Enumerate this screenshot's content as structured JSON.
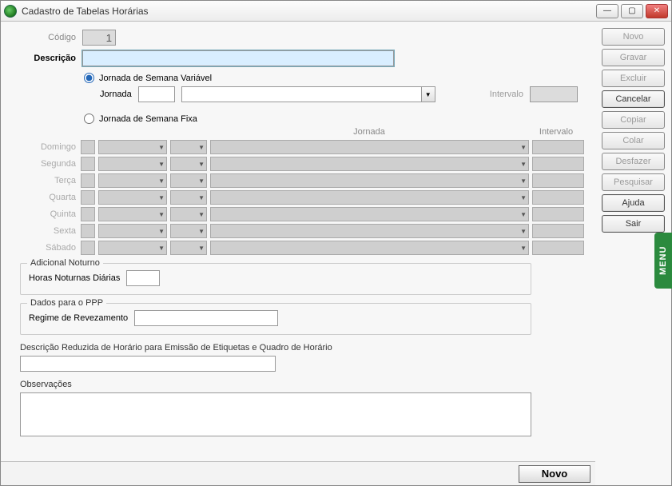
{
  "window": {
    "title": "Cadastro de Tabelas Horárias"
  },
  "fields": {
    "codigo_label": "Código",
    "codigo_value": "1",
    "descricao_label": "Descrição",
    "descricao_value": "",
    "jornada_var_label": "Jornada de Semana Variável",
    "jornada_fixa_label": "Jornada de Semana Fixa",
    "jornada_sub_label": "Jornada",
    "intervalo_label": "Intervalo",
    "jornada_header": "Jornada",
    "intervalo_header": "Intervalo"
  },
  "days": [
    "Domingo",
    "Segunda",
    "Terça",
    "Quarta",
    "Quinta",
    "Sexta",
    "Sábado"
  ],
  "adicional_noturno": {
    "legend": "Adicional Noturno",
    "horas_label": "Horas Noturnas Diárias",
    "horas_value": ""
  },
  "ppp": {
    "legend": "Dados para o PPP",
    "regime_label": "Regime de Revezamento",
    "regime_value": ""
  },
  "descricao_reduzida": {
    "label": "Descrição Reduzida de Horário para Emissão de Etiquetas e Quadro de Horário",
    "value": ""
  },
  "observacoes": {
    "label": "Observações",
    "value": ""
  },
  "buttons": {
    "novo": "Novo",
    "gravar": "Gravar",
    "excluir": "Excluir",
    "cancelar": "Cancelar",
    "copiar": "Copiar",
    "colar": "Colar",
    "desfazer": "Desfazer",
    "pesquisar": "Pesquisar",
    "ajuda": "Ajuda",
    "sair": "Sair",
    "status_novo": "Novo"
  },
  "menu_tab": "MENU"
}
